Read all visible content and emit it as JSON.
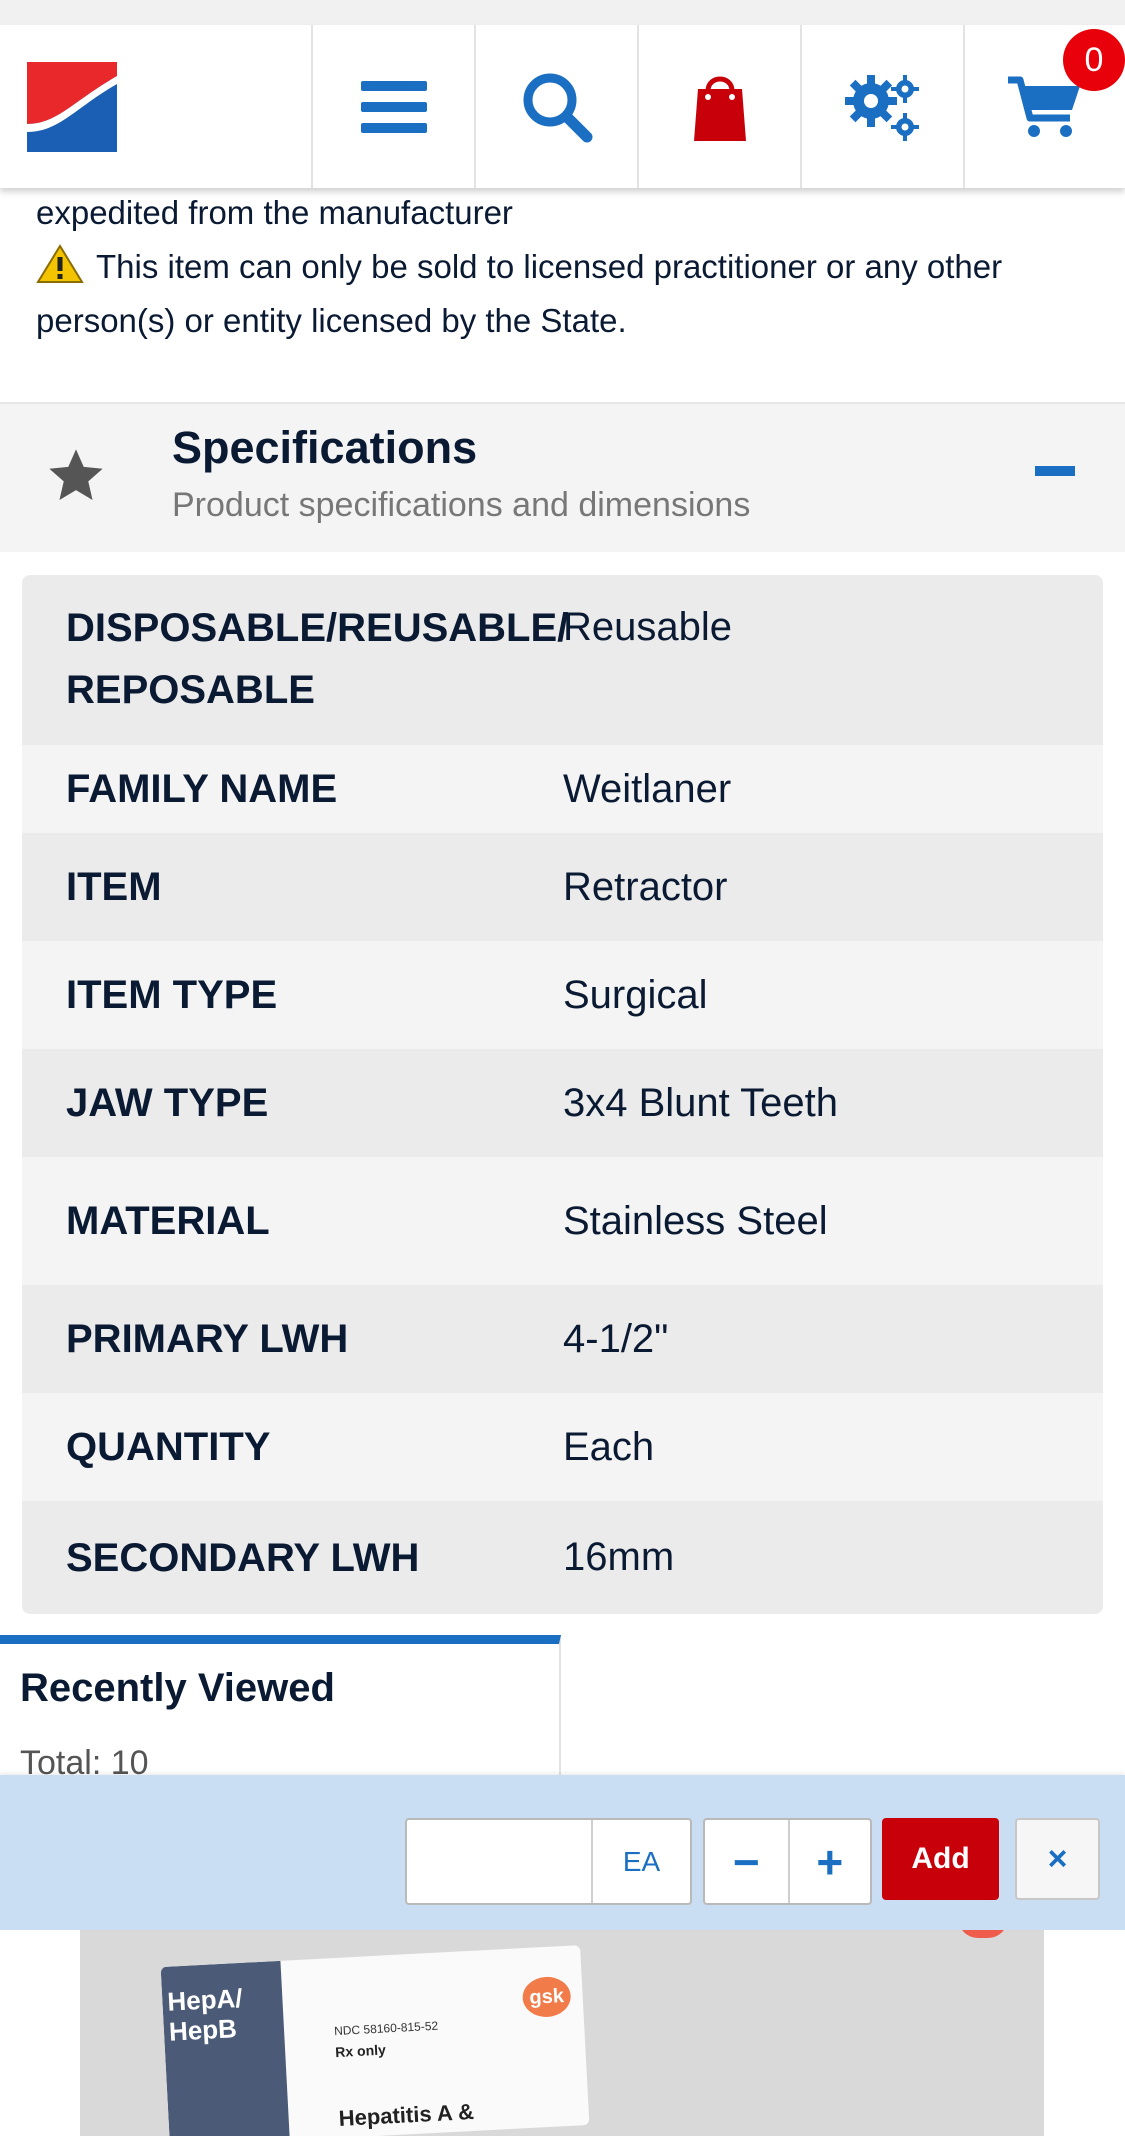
{
  "header": {
    "cart_count": "0",
    "icons": [
      "menu-icon",
      "search-icon",
      "shopping-bag-icon",
      "settings-gears-icon",
      "cart-icon"
    ],
    "colors": {
      "brand_red": "#e8282b",
      "brand_blue": "#1a6fc2"
    }
  },
  "notice": {
    "line1": "expedited from the manufacturer",
    "warning": "This item can only be sold to licensed practitioner or any other person(s) or entity licensed by the State."
  },
  "specifications": {
    "title": "Specifications",
    "subtitle": "Product specifications and dimensions",
    "rows": [
      {
        "key": "DISPOSABLE/REUSABLE/ REPOSABLE",
        "value": "Reusable"
      },
      {
        "key": "FAMILY NAME",
        "value": "Weitlaner"
      },
      {
        "key": "ITEM",
        "value": "Retractor"
      },
      {
        "key": "ITEM TYPE",
        "value": "Surgical"
      },
      {
        "key": "JAW TYPE",
        "value": "3x4 Blunt Teeth"
      },
      {
        "key": "MATERIAL",
        "value": "Stainless Steel"
      },
      {
        "key": "PRIMARY LWH",
        "value": "4-1/2\""
      },
      {
        "key": "QUANTITY",
        "value": "Each"
      },
      {
        "key": "SECONDARY LWH",
        "value": "16mm"
      }
    ]
  },
  "recently_viewed": {
    "title": "Recently Viewed",
    "total": "Total: 10"
  },
  "product_preview": {
    "brand_line1": "HepA/",
    "brand_line2": "HepB",
    "ndc": "NDC 58160-815-52",
    "rx": "Rx only",
    "name": "Hepatitis A &",
    "maker": "gsk"
  },
  "cart_bar": {
    "quantity_value": "",
    "unit": "EA",
    "minus": "−",
    "plus": "+",
    "add_label": "Add",
    "close": "×"
  }
}
